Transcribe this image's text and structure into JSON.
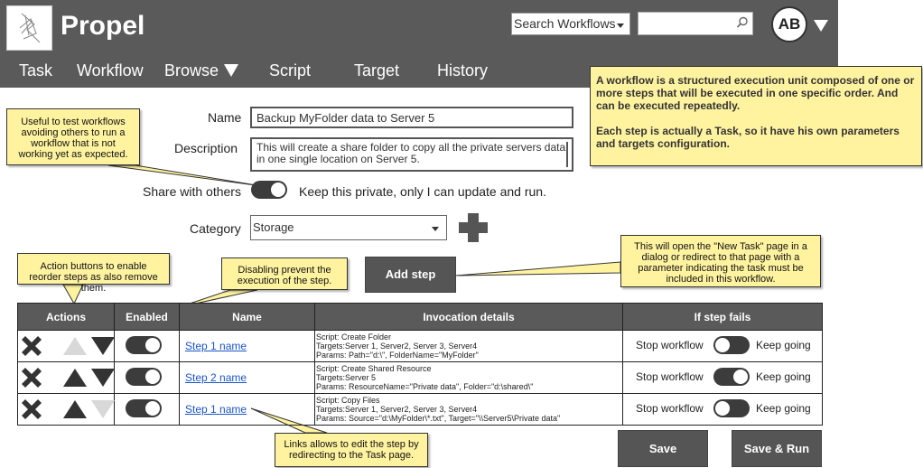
{
  "app": {
    "title": "Propel"
  },
  "header": {
    "search_select": "Search Workflows",
    "search_value": "",
    "avatar_initials": "AB"
  },
  "nav": [
    {
      "label": "Task"
    },
    {
      "label": "Workflow"
    },
    {
      "label": "Browse"
    },
    {
      "label": "Script"
    },
    {
      "label": "Target"
    },
    {
      "label": "History"
    }
  ],
  "form": {
    "name_label": "Name",
    "name_value": "Backup MyFolder data to Server 5",
    "description_label": "Description",
    "description_value": "This will create a share folder to copy all the private servers data in one single location on Server 5.",
    "share_label": "Share with others",
    "share_toggle_on": true,
    "share_text": "Keep this private, only I can update and run.",
    "category_label": "Category",
    "category_value": "Storage"
  },
  "buttons": {
    "add_step": "Add step",
    "save": "Save",
    "save_run": "Save & Run"
  },
  "table": {
    "headers": [
      "Actions",
      "Enabled",
      "Name",
      "Invocation details",
      "If step fails"
    ],
    "rows": [
      {
        "name": "Step 1 name",
        "details": [
          "Script: Create Folder",
          "Targets:Server 1, Server2, Server 3, Server4",
          "Params: Path=\"d:\\\", FolderName=\"MyFolder\""
        ],
        "stop_label": "Stop workflow",
        "keep_label": "Keep going",
        "keep_going": false,
        "up_enabled": false,
        "down_enabled": true,
        "enabled": true
      },
      {
        "name": "Step 2 name",
        "details": [
          "Script: Create Shared Resource",
          "Targets:Server 5",
          "Params: ResourceName=\"Private data\", Folder=\"d:\\shared\\\""
        ],
        "stop_label": "Stop workflow",
        "keep_label": "Keep going",
        "keep_going": true,
        "up_enabled": true,
        "down_enabled": true,
        "enabled": true
      },
      {
        "name": "Step 1 name",
        "details": [
          "Script: Copy Files",
          "Targets:Server 1, Server2, Server 3, Server4",
          "Params: Source=\"d:\\MyFolder\\*.txt\", Target=\"\\\\Server5\\Private data\""
        ],
        "stop_label": "Stop workflow",
        "keep_label": "Keep going",
        "keep_going": false,
        "up_enabled": true,
        "down_enabled": false,
        "enabled": true
      }
    ]
  },
  "notes": {
    "workflow": "A workflow is a structured execution unit composed of one or more steps that will be executed in one specific order. And can be executed repeatedly.",
    "workflow_2": "Each step is actually a Task, so it have his own parameters and targets configuration.",
    "share": "Useful to test workflows avoiding others to run a workflow that is not working yet as expected.",
    "actions": "Action buttons to enable reorder steps as also remove them.",
    "disabling": "Disabling prevent the execution of the step.",
    "new_task": "This will open the \"New Task\" page in a dialog or redirect to that page with a parameter indicating the task must be included in this workflow.",
    "links": "Links allows to edit the step by redirecting to the Task page."
  },
  "colors": {
    "header_bg": "#5a5a5a",
    "note_bg": "#fff3a0",
    "link": "#1a55c8",
    "disabled_arrow": "#d8d8d8"
  }
}
